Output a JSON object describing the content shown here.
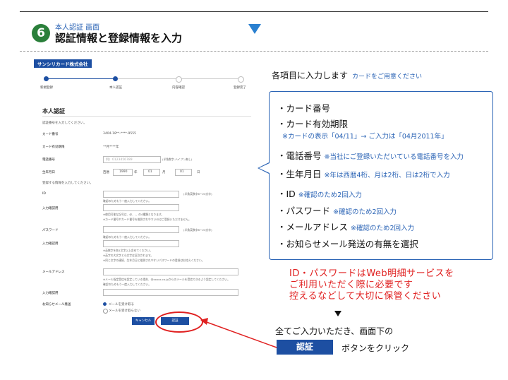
{
  "header": {
    "step_number": "6",
    "step_subtitle": "本人認証 画面",
    "step_title": "認証情報と登録情報を入力"
  },
  "form": {
    "logo": "サンシリカード株式会社",
    "progress": [
      {
        "label": "新規登録",
        "active": true
      },
      {
        "label": "本人認証",
        "active": true
      },
      {
        "label": "内容確認",
        "active": false
      },
      {
        "label": "登録完了",
        "active": false
      }
    ],
    "title": "本人認証",
    "intro": "認証番号を入力してください。",
    "card_number_label": "カード番号",
    "card_number_value": "3404-18**-****-9555",
    "card_expiry_label": "カード有効期限",
    "card_expiry_value": "**月****年",
    "phone_label": "電話番号",
    "phone_placeholder": "例）0123456789",
    "phone_hint": "(半角数字-ハイフン無し)",
    "birth_label": "生年月日",
    "birth_era": "西暦",
    "birth_year": "1990",
    "birth_year_unit": "年",
    "birth_month": "01",
    "birth_month_unit": "月",
    "birth_day": "01",
    "birth_day_unit": "日",
    "reg_intro": "登録する情報を入力してください。",
    "id_label": "ID",
    "id_hint": "(半角英数字6～20文字)",
    "id_note": "確認のためもう一度入力してください。",
    "id_confirm_label": "入力確認用",
    "id_notes2": "※使用可能な記号は、@、-、の4種類となります。",
    "id_notes3": "※カード番号やカード番号を推測されやすいIDはご登録いただけません。",
    "pw_label": "パスワード",
    "pw_hint": "(半角英数字8～20文字)",
    "pw_note": "確認のためもう一度入力してください。",
    "pw_confirm_label": "入力確認用",
    "pw_notes1": "※英数字を各1文字以上含めてください。",
    "pw_notes2": "※英字の大文字と小文字は区別されます。",
    "pw_notes3": "※同じ文字の連続、生年月日と推測されやすいパスワードの登録はお控えください。",
    "mail_label": "メールアドレス",
    "mail_note1": "※メール指定受信を設定している場合、@xxxxx.co.jpからのメールを受信できるよう設定してください。",
    "mail_note2": "確認のためもう一度入力してください。",
    "mail_confirm_label": "入力確認用",
    "notify_label": "お知らせメール発送",
    "notify_opt1": "メールを受け取る",
    "notify_opt2": "メールを受け取らない",
    "cancel_button": "キャンセル",
    "auth_button": "認証"
  },
  "right": {
    "lead": "各項目に入力します",
    "lead_sub": "カードをご用意ください",
    "items": [
      {
        "text": "・カード番号",
        "note": ""
      },
      {
        "text": "・カード有効期限",
        "note": ""
      },
      {
        "text": "・電話番号",
        "note": "※当社にご登録いただいている電話番号を入力"
      },
      {
        "text": "・生年月日",
        "note": "※年は西暦4桁、月は2桁、日は2桁で入力"
      },
      {
        "text": "・ID",
        "note": "※確認のため2回入力"
      },
      {
        "text": "・パスワード",
        "note": "※確認のため2回入力"
      },
      {
        "text": "・メールアドレス",
        "note": "※確認のため2回入力"
      },
      {
        "text": "・お知らせメール発送の有無を選択",
        "note": ""
      }
    ],
    "expiry_note": "※カードの表示「04/11」→ ご入力は「04月2011年」",
    "warning": [
      "ID・パスワードはWeb明細サービスを",
      "ご利用いただく際に必要です",
      "控えるなどして大切に保管ください"
    ],
    "final_text": "全てご入力いただき、画面下の",
    "final_button": "認証",
    "final_after": "ボタンをクリック"
  },
  "colors": {
    "brand_blue": "#1d4fa2",
    "accent_red": "#e02020",
    "step_green": "#2a7f3a"
  }
}
